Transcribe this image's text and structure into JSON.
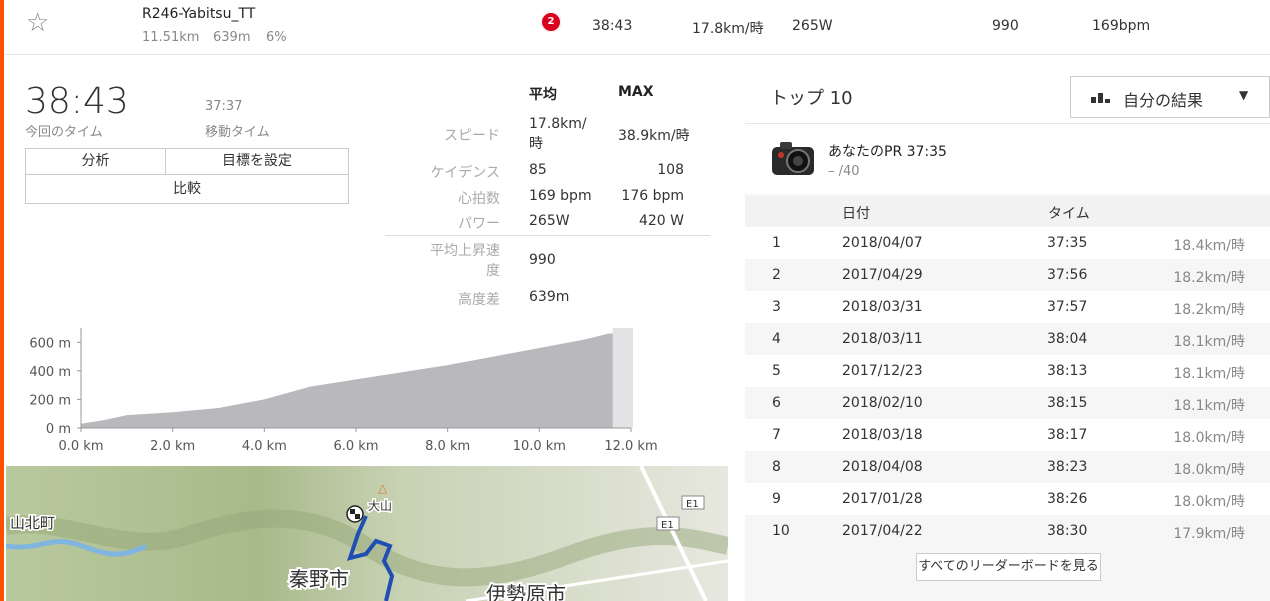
{
  "segment": {
    "name": "R246-Yabitsu_TT",
    "distance": "11.51km",
    "elevation": "639m",
    "grade": "6%",
    "rank": "2",
    "time": "38:43",
    "speed": "17.8km/時",
    "power": "265W",
    "vam": "990",
    "heart_rate": "169bpm"
  },
  "effort": {
    "elapsed_time": "38:43",
    "elapsed_label": "今回のタイム",
    "moving_time": "37:37",
    "moving_label": "移動タイム",
    "buttons": {
      "analysis": "分析",
      "set_goal": "目標を設定",
      "compare": "比較"
    }
  },
  "stats": {
    "head_avg": "平均",
    "head_max": "MAX",
    "rows": [
      {
        "label": "スピード",
        "avg": "17.8km/時",
        "max": "38.9km/時"
      },
      {
        "label": "ケイデンス",
        "avg": "85",
        "max": "108"
      },
      {
        "label": "心拍数",
        "avg": "169 bpm",
        "max": "176 bpm"
      },
      {
        "label": "パワー",
        "avg": "265W",
        "max": "420 W"
      },
      {
        "label": "平均上昇速度",
        "avg": "990",
        "max": ""
      },
      {
        "label": "高度差",
        "avg": "639m",
        "max": ""
      }
    ]
  },
  "chart_data": {
    "type": "area",
    "title": "",
    "xlabel": "",
    "ylabel": "",
    "x": [
      0,
      0.5,
      1,
      2,
      3,
      4,
      5,
      6,
      7,
      8,
      9,
      10,
      11,
      11.5,
      12
    ],
    "y": [
      30,
      55,
      90,
      110,
      140,
      200,
      290,
      340,
      390,
      440,
      500,
      560,
      620,
      660,
      680
    ],
    "xlim": [
      0,
      12
    ],
    "ylim": [
      0,
      700
    ],
    "xticks": [
      "0.0 km",
      "2.0 km",
      "4.0 km",
      "6.0 km",
      "8.0 km",
      "10.0 km",
      "12.0 km"
    ],
    "yticks": [
      "0 m",
      "200 m",
      "400 m",
      "600 m"
    ],
    "fill_color": "#b9b9bd",
    "grid": false
  },
  "map": {
    "labels": [
      "山北町",
      "大山",
      "秦野市",
      "伊勢原市",
      "E1",
      "E1"
    ],
    "route_color": "#1f4fb3"
  },
  "leaderboard": {
    "title": "トップ 10",
    "filter_label": "自分の結果",
    "pr_text": "あなたのPR 37:35",
    "pr_rank": "– /40",
    "col_date": "日付",
    "col_time": "タイム",
    "rows": [
      {
        "rank": "1",
        "date": "2018/04/07",
        "time": "37:35",
        "speed": "18.4km/時"
      },
      {
        "rank": "2",
        "date": "2017/04/29",
        "time": "37:56",
        "speed": "18.2km/時"
      },
      {
        "rank": "3",
        "date": "2018/03/31",
        "time": "37:57",
        "speed": "18.2km/時"
      },
      {
        "rank": "4",
        "date": "2018/03/11",
        "time": "38:04",
        "speed": "18.1km/時"
      },
      {
        "rank": "5",
        "date": "2017/12/23",
        "time": "38:13",
        "speed": "18.1km/時"
      },
      {
        "rank": "6",
        "date": "2018/02/10",
        "time": "38:15",
        "speed": "18.1km/時"
      },
      {
        "rank": "7",
        "date": "2018/03/18",
        "time": "38:17",
        "speed": "18.0km/時"
      },
      {
        "rank": "8",
        "date": "2018/04/08",
        "time": "38:23",
        "speed": "18.0km/時"
      },
      {
        "rank": "9",
        "date": "2017/01/28",
        "time": "38:26",
        "speed": "18.0km/時"
      },
      {
        "rank": "10",
        "date": "2017/04/22",
        "time": "38:30",
        "speed": "17.9km/時"
      }
    ],
    "view_all": "すべてのリーダーボードを見る"
  },
  "colors": {
    "accent": "#fc5200",
    "rank_badge": "#d9001b"
  }
}
